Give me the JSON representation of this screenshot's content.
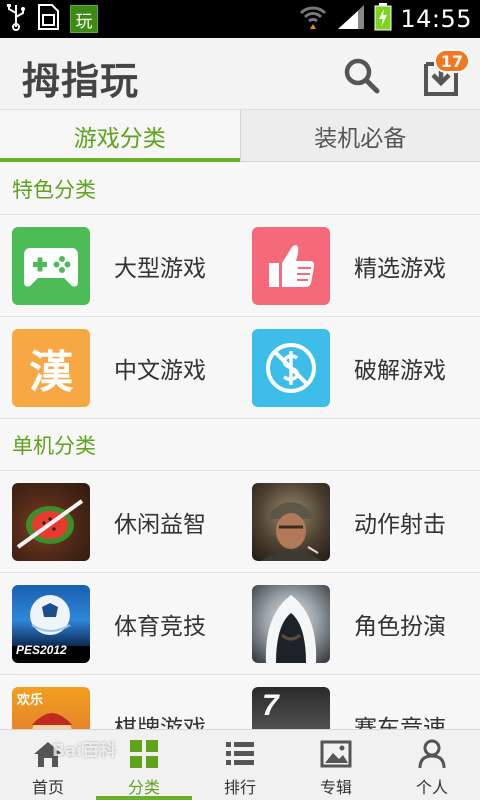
{
  "status_bar": {
    "time": "14:55",
    "app_badge": "玩",
    "icons": [
      "usb-icon",
      "sim-icon",
      "app-notification-icon",
      "wifi-icon",
      "signal-icon",
      "battery-charging-icon"
    ]
  },
  "header": {
    "title": "拇指玩",
    "download_badge": "17",
    "icons": [
      "search-icon",
      "download-icon"
    ]
  },
  "tabs": [
    {
      "label": "游戏分类",
      "active": true
    },
    {
      "label": "装机必备",
      "active": false
    }
  ],
  "sections": [
    {
      "title": "特色分类",
      "items": [
        {
          "label": "大型游戏",
          "icon": "gamepad-icon"
        },
        {
          "label": "精选游戏",
          "icon": "thumbs-up-icon"
        },
        {
          "label": "中文游戏",
          "icon": "han-character-icon",
          "icon_text": "漢"
        },
        {
          "label": "破解游戏",
          "icon": "dollar-prohibited-icon"
        }
      ]
    },
    {
      "title": "单机分类",
      "items": [
        {
          "label": "休闲益智",
          "icon": "fruit-ninja-thumbnail"
        },
        {
          "label": "动作射击",
          "icon": "soldier-thumbnail"
        },
        {
          "label": "体育竞技",
          "icon": "pes2012-thumbnail",
          "icon_text": "PES2012"
        },
        {
          "label": "角色扮演",
          "icon": "assassin-thumbnail"
        },
        {
          "label": "棋牌游戏",
          "icon": "card-game-thumbnail",
          "icon_text": "欢乐"
        },
        {
          "label": "赛车竞速",
          "icon": "racing-thumbnail",
          "icon_text": "7"
        }
      ]
    }
  ],
  "bottom_nav": [
    {
      "label": "首页",
      "icon": "home-icon",
      "active": false
    },
    {
      "label": "分类",
      "icon": "grid-icon",
      "active": true
    },
    {
      "label": "排行",
      "icon": "list-icon",
      "active": false
    },
    {
      "label": "专辑",
      "icon": "image-album-icon",
      "active": false
    },
    {
      "label": "个人",
      "icon": "person-icon",
      "active": false
    }
  ],
  "watermark": "Bai百科",
  "colors": {
    "accent": "#6bb02a",
    "accent_text": "#5fa31f",
    "badge": "#f6761e",
    "gamepad_bg": "#4cbc57",
    "thumbs_bg": "#f6697a",
    "han_bg": "#f7a743",
    "crack_bg": "#3dbde9"
  }
}
